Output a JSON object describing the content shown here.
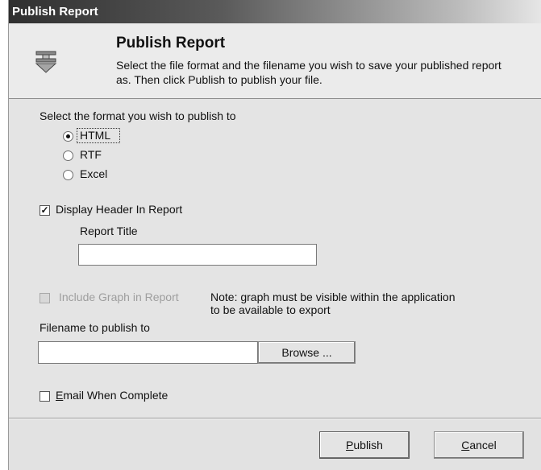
{
  "window": {
    "title": "Publish Report"
  },
  "header": {
    "title": "Publish Report",
    "description": "Select the file format and the filename you wish to save your published report as. Then click Publish to publish your file."
  },
  "format": {
    "label": "Select the format you wish to publish to",
    "options": [
      {
        "label": "HTML",
        "selected": true
      },
      {
        "label": "RTF",
        "selected": false
      },
      {
        "label": "Excel",
        "selected": false
      }
    ]
  },
  "display_header": {
    "label": "Display Header In Report",
    "checked": true
  },
  "report_title": {
    "label": "Report Title",
    "value": ""
  },
  "include_graph": {
    "label": "Include Graph in Report",
    "checked": false,
    "enabled": false,
    "note_line1": "Note: graph must be visible within the application",
    "note_line2": "to be available to export"
  },
  "filename": {
    "label": "Filename to publish to",
    "value": "",
    "browse_label": "Browse ..."
  },
  "email": {
    "label_first": "E",
    "label_rest": "mail When Complete",
    "checked": false
  },
  "buttons": {
    "publish_first": "P",
    "publish_rest": "ublish",
    "cancel_first": "C",
    "cancel_rest": "ancel"
  },
  "icons": {
    "header_icon": "publish-report-icon"
  }
}
